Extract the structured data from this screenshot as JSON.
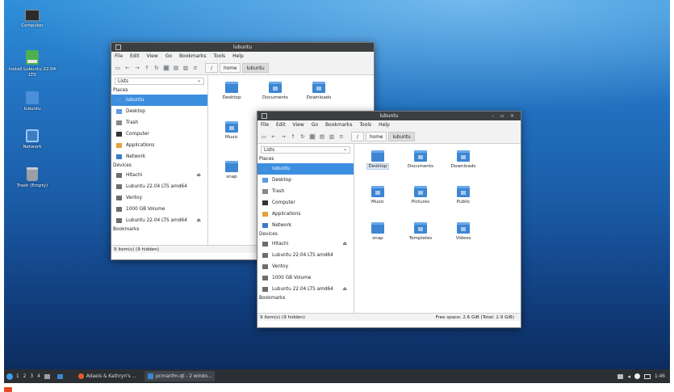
{
  "desktop": {
    "icons": [
      {
        "label": "Computer"
      },
      {
        "label": "Install Lubuntu 22.04 LTS"
      },
      {
        "label": "lubuntu"
      },
      {
        "label": "Network"
      },
      {
        "label": "Trash (Empty)"
      }
    ]
  },
  "win_back": {
    "title": "lubuntu",
    "menu": [
      "File",
      "Edit",
      "View",
      "Go",
      "Bookmarks",
      "Tools",
      "Help"
    ],
    "path": {
      "root": "/",
      "crumbs": [
        "home",
        "lubuntu"
      ]
    },
    "lists_label": "Lists",
    "places_head": "Places",
    "places": [
      "lubuntu",
      "Desktop",
      "Trash",
      "Computer",
      "Applications",
      "Network"
    ],
    "devices_head": "Devices",
    "devices": [
      "Hitachi",
      "Lubuntu 22.04 LTS amd64",
      "Ventoy",
      "1000 GB Volume",
      "Lubuntu 22.04 LTS amd64"
    ],
    "bookmarks_head": "Bookmarks",
    "files": [
      "Desktop",
      "Documents",
      "Downloads",
      "Music",
      "snap"
    ],
    "status": "9 item(s) (9 hidden)"
  },
  "win_front": {
    "title": "lubuntu",
    "controls": "– ▫ ×",
    "menu": [
      "File",
      "Edit",
      "View",
      "Go",
      "Bookmarks",
      "Tools",
      "Help"
    ],
    "path": {
      "root": "/",
      "crumbs": [
        "home",
        "lubuntu"
      ]
    },
    "lists_label": "Lists",
    "places_head": "Places",
    "places": [
      "lubuntu",
      "Desktop",
      "Trash",
      "Computer",
      "Applications",
      "Network"
    ],
    "devices_head": "Devices",
    "devices": [
      "Hitachi",
      "Lubuntu 22.04 LTS amd64",
      "Ventoy",
      "1000 GB Volume",
      "Lubuntu 22.04 LTS amd64"
    ],
    "bookmarks_head": "Bookmarks",
    "files": [
      "Desktop",
      "Documents",
      "Downloads",
      "Music",
      "Pictures",
      "Public",
      "snap",
      "Templates",
      "Videos"
    ],
    "status": "9 item(s) (9 hidden)",
    "free_space": "Free space: 2.6 GiB (Total: 2.9 GiB)"
  },
  "taskbar": {
    "workspaces": [
      "1",
      "2",
      "3",
      "4"
    ],
    "tasks": [
      {
        "label": "Adaeis & Kathryn's ..."
      },
      {
        "label": "pcmanfm-qt - 2 windo..."
      }
    ],
    "clock": "1:46"
  },
  "colors": {
    "selection": "#3c8fe0",
    "folder": "#3c86d4",
    "titlebar": "#3c3f41",
    "taskbar": "#2b2f33"
  }
}
